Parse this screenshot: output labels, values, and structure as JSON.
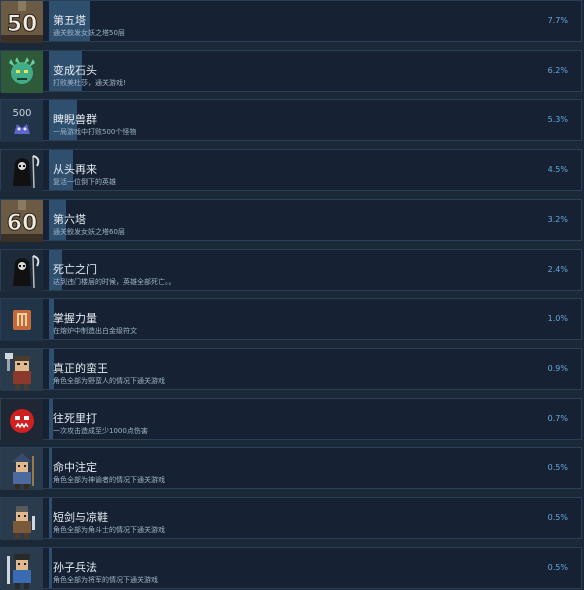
{
  "achievements": [
    {
      "title": "第五塔",
      "description": "通关鲛发女妖之塔50层",
      "percent": "7.7%",
      "progress": 7.7,
      "icon": "tower-50-icon"
    },
    {
      "title": "变成石头",
      "description": "打败美杜莎，通关游戏!",
      "percent": "6.2%",
      "progress": 6.2,
      "icon": "medusa-icon"
    },
    {
      "title": "睥睨兽群",
      "description": "一局游戏中打败500个怪物",
      "percent": "5.3%",
      "progress": 5.3,
      "icon": "monsters-500-icon"
    },
    {
      "title": "从头再来",
      "description": "复活一位倒下的英雄",
      "percent": "4.5%",
      "progress": 4.5,
      "icon": "reaper-icon"
    },
    {
      "title": "第六塔",
      "description": "通关鲛发女妖之塔60层",
      "percent": "3.2%",
      "progress": 3.2,
      "icon": "tower-60-icon"
    },
    {
      "title": "死亡之门",
      "description": "达到违门楼层的时候，英雄全部死亡。。",
      "percent": "2.4%",
      "progress": 2.4,
      "icon": "reaper-icon"
    },
    {
      "title": "掌握力量",
      "description": "在熔炉中制造出白金级符文",
      "percent": "1.0%",
      "progress": 1.0,
      "icon": "rune-icon"
    },
    {
      "title": "真正的蛮王",
      "description": "角色全部为野蛮人的情况下通关游戏",
      "percent": "0.9%",
      "progress": 0.9,
      "icon": "barbarian-icon"
    },
    {
      "title": "往死里打",
      "description": "一次攻击造成至少1000点伤害",
      "percent": "0.7%",
      "progress": 0.7,
      "icon": "red-demon-icon"
    },
    {
      "title": "命中注定",
      "description": "角色全部为神谕者的情况下通关游戏",
      "percent": "0.5%",
      "progress": 0.5,
      "icon": "oracle-icon"
    },
    {
      "title": "短剑与凉鞋",
      "description": "角色全部为角斗士的情况下通关游戏",
      "percent": "0.5%",
      "progress": 0.5,
      "icon": "gladiator-icon"
    },
    {
      "title": "孙子兵法",
      "description": "角色全部为将军的情况下通关游戏",
      "percent": "0.5%",
      "progress": 0.5,
      "icon": "general-icon"
    }
  ],
  "colors": {
    "background": "#1b2838",
    "row": "#162233",
    "progress_fill": "#2e4f6e",
    "percent_text": "#67a9dd"
  }
}
